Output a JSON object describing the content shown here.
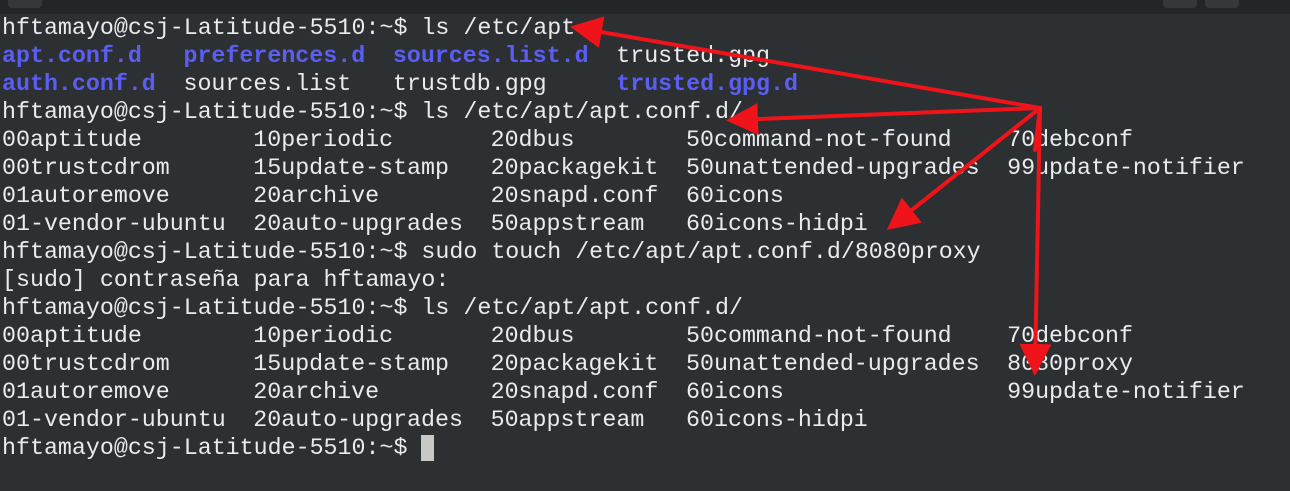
{
  "window": {
    "buttons": [
      "minimize",
      "close"
    ]
  },
  "terminal": {
    "prompt": "hftamayo@csj-Latitude-5510:~$ ",
    "lines": [
      {
        "type": "cmd",
        "cmd": "ls /etc/apt"
      },
      {
        "type": "row",
        "cells": [
          {
            "text": "apt.conf.d",
            "col": 0,
            "dir": true
          },
          {
            "text": "preferences.d",
            "col": 13,
            "dir": true
          },
          {
            "text": "sources.list.d",
            "col": 28,
            "dir": true
          },
          {
            "text": "trusted.gpg",
            "col": 44,
            "dir": false
          }
        ]
      },
      {
        "type": "row",
        "cells": [
          {
            "text": "auth.conf.d",
            "col": 0,
            "dir": true
          },
          {
            "text": "sources.list",
            "col": 13,
            "dir": false
          },
          {
            "text": "trustdb.gpg",
            "col": 28,
            "dir": false
          },
          {
            "text": "trusted.gpg.d",
            "col": 44,
            "dir": true
          }
        ]
      },
      {
        "type": "cmd",
        "cmd": "ls /etc/apt/apt.conf.d/"
      },
      {
        "type": "row",
        "cells": [
          {
            "text": "00aptitude",
            "col": 0
          },
          {
            "text": "10periodic",
            "col": 18
          },
          {
            "text": "20dbus",
            "col": 35
          },
          {
            "text": "50command-not-found",
            "col": 49
          },
          {
            "text": "70debconf",
            "col": 72
          }
        ]
      },
      {
        "type": "row",
        "cells": [
          {
            "text": "00trustcdrom",
            "col": 0
          },
          {
            "text": "15update-stamp",
            "col": 18
          },
          {
            "text": "20packagekit",
            "col": 35
          },
          {
            "text": "50unattended-upgrades",
            "col": 49
          },
          {
            "text": "99update-notifier",
            "col": 72
          }
        ]
      },
      {
        "type": "row",
        "cells": [
          {
            "text": "01autoremove",
            "col": 0
          },
          {
            "text": "20archive",
            "col": 18
          },
          {
            "text": "20snapd.conf",
            "col": 35
          },
          {
            "text": "60icons",
            "col": 49
          }
        ]
      },
      {
        "type": "row",
        "cells": [
          {
            "text": "01-vendor-ubuntu",
            "col": 0
          },
          {
            "text": "20auto-upgrades",
            "col": 18
          },
          {
            "text": "50appstream",
            "col": 35
          },
          {
            "text": "60icons-hidpi",
            "col": 49
          }
        ]
      },
      {
        "type": "cmd",
        "cmd": "sudo touch /etc/apt/apt.conf.d/8080proxy"
      },
      {
        "type": "text",
        "text": "[sudo] contraseña para hftamayo:"
      },
      {
        "type": "cmd",
        "cmd": "ls /etc/apt/apt.conf.d/"
      },
      {
        "type": "row",
        "cells": [
          {
            "text": "00aptitude",
            "col": 0
          },
          {
            "text": "10periodic",
            "col": 18
          },
          {
            "text": "20dbus",
            "col": 35
          },
          {
            "text": "50command-not-found",
            "col": 49
          },
          {
            "text": "70debconf",
            "col": 72
          }
        ]
      },
      {
        "type": "row",
        "cells": [
          {
            "text": "00trustcdrom",
            "col": 0
          },
          {
            "text": "15update-stamp",
            "col": 18
          },
          {
            "text": "20packagekit",
            "col": 35
          },
          {
            "text": "50unattended-upgrades",
            "col": 49
          },
          {
            "text": "8080proxy",
            "col": 72
          }
        ]
      },
      {
        "type": "row",
        "cells": [
          {
            "text": "01autoremove",
            "col": 0
          },
          {
            "text": "20archive",
            "col": 18
          },
          {
            "text": "20snapd.conf",
            "col": 35
          },
          {
            "text": "60icons",
            "col": 49
          },
          {
            "text": "99update-notifier",
            "col": 72
          }
        ]
      },
      {
        "type": "row",
        "cells": [
          {
            "text": "01-vendor-ubuntu",
            "col": 0
          },
          {
            "text": "20auto-upgrades",
            "col": 18
          },
          {
            "text": "50appstream",
            "col": 35
          },
          {
            "text": "60icons-hidpi",
            "col": 49
          }
        ]
      },
      {
        "type": "cmd",
        "cmd": "",
        "cursor": true
      }
    ]
  },
  "annotation": {
    "color": "#f0141a",
    "arrows": 5
  },
  "colors": {
    "background": "#2c3033",
    "text": "#ebebeb",
    "directory": "#5b5ef5",
    "cursor": "#c8c8c4"
  }
}
